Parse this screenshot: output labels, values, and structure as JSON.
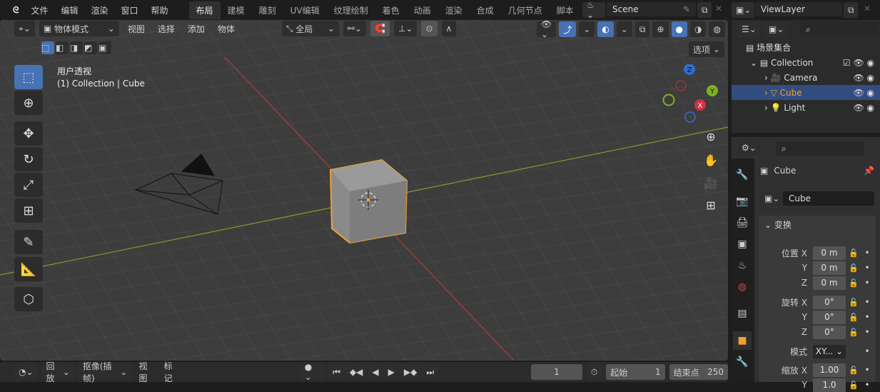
{
  "menu": [
    "文件",
    "编辑",
    "渲染",
    "窗口",
    "帮助"
  ],
  "workspaces": [
    "布局",
    "建模",
    "雕刻",
    "UV编辑",
    "纹理绘制",
    "着色",
    "动画",
    "渲染",
    "合成",
    "几何节点",
    "脚本"
  ],
  "active_workspace": "布局",
  "scene": "Scene",
  "view_layer": "ViewLayer",
  "viewport": {
    "mode": "物体模式",
    "menus": [
      "视图",
      "选择",
      "添加",
      "物体"
    ],
    "orientation": "全局",
    "options": "选项",
    "overlay_title": "用户透视",
    "overlay_sub": "(1) Collection | Cube",
    "gizmo": {
      "z": "Z",
      "y": "Y",
      "x": "X"
    },
    "tools": [
      "select-box",
      "cursor",
      "move",
      "rotate",
      "scale",
      "transform",
      "annotate",
      "measure",
      "add-cube"
    ]
  },
  "outliner": {
    "root": "场景集合",
    "items": [
      {
        "label": "Collection",
        "icon": "collection"
      },
      {
        "label": "Camera",
        "icon": "camera"
      },
      {
        "label": "Cube",
        "icon": "mesh",
        "selected": true
      },
      {
        "label": "Light",
        "icon": "light"
      }
    ]
  },
  "properties": {
    "object": "Cube",
    "data_name": "Cube",
    "section": "变换",
    "location_label": "位置",
    "rotation_label": "旋转",
    "mode_label": "模式",
    "scale_label": "缩放",
    "loc": [
      "0 m",
      "0 m",
      "0 m"
    ],
    "rot": [
      "0°",
      "0°",
      "0°"
    ],
    "mode": "XY...",
    "scale": [
      "1.00",
      "1.0"
    ],
    "axes": [
      "X",
      "Y",
      "Z"
    ]
  },
  "timeline": {
    "playback": "回放",
    "keying": "抠像(插帧)",
    "view": "视图",
    "marker": "标记",
    "current_frame": "1",
    "start_label": "起始",
    "start": "1",
    "end_label": "结束点",
    "end": "250"
  },
  "colors": {
    "accent": "#4772b3",
    "selection": "#f0a030",
    "x_axis": "#a83a3a",
    "y_axis": "#7a9a2a"
  }
}
